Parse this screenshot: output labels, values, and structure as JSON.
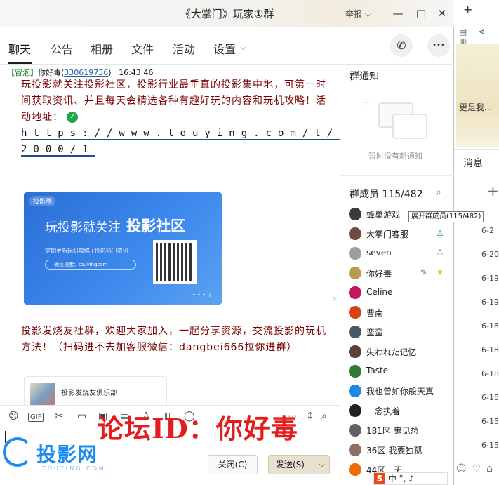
{
  "window": {
    "title": "《大掌门》玩家①群",
    "report": "举报",
    "btn_min": "—",
    "btn_max": "□",
    "btn_close": "✕"
  },
  "tabs": [
    "聊天",
    "公告",
    "相册",
    "文件",
    "活动",
    "设置"
  ],
  "tab_more": "⌵",
  "round_btns": {
    "phone": "✆",
    "more": "•••"
  },
  "message": {
    "tag": "【冒泡】",
    "sender": "你好毒",
    "uid": "330619736",
    "time": "16:43:46",
    "para1": "玩投影就关注投影社区，投影行业最垂直的投影集中地，可第一时间获取资讯、并且每天会精选各种有趣好玩的内容和玩机攻略！活动地址：",
    "verified": "✓",
    "link_line1": "https://www.touying.com/t/1",
    "link_line2": "2000/1",
    "banner": {
      "logo": "投影圈",
      "big1": "玩投影就关注",
      "big2": "投影社区",
      "small": "定期更新玩机攻略+投影热门资讯",
      "pill": "微信搜索：touyingcom",
      "dots": "• • • +"
    },
    "para2": "投影发烧友社群，欢迎大家加入，一起分享资源，交流投影的玩机方法！（扫码进不去加客服微信：dangbei666拉你进群）",
    "card_title": "投影发烧友俱乐部"
  },
  "toolbar": [
    "☺",
    "GIF",
    "✂",
    "▭",
    "▣",
    "▤",
    "♙",
    "▥",
    "◯",
    "⋯",
    "↕",
    "⌕"
  ],
  "watermark": {
    "text": "投影网",
    "sub": "TOUYING.COM"
  },
  "overlay": "论坛ID：你好毒",
  "buttons": {
    "close": "关闭(C)",
    "send": "发送(S)",
    "send_arrow": "⌵"
  },
  "notice": {
    "title": "群通知",
    "empty": "暂时没有新通知"
  },
  "members": {
    "header": "群成员 115/482",
    "tooltip": "展开群成员(115/482)",
    "list": [
      {
        "name": "蜂巢游戏",
        "color": "#3a3a3a",
        "badge": ""
      },
      {
        "name": "大掌门客服",
        "color": "#6d4c41",
        "badge": "♙"
      },
      {
        "name": "seven",
        "color": "#9e9e9e",
        "badge": "♙"
      },
      {
        "name": "你好毒",
        "color": "#b89c4a",
        "badge": "★",
        "edit": "✎"
      },
      {
        "name": "Celine",
        "color": "#c2185b",
        "badge": ""
      },
      {
        "name": "曹南",
        "color": "#d84315",
        "badge": ""
      },
      {
        "name": "蛮蛮",
        "color": "#455a64",
        "badge": ""
      },
      {
        "name": "失われた记忆",
        "color": "#5d4037",
        "badge": ""
      },
      {
        "name": "Taste",
        "color": "#2e7d32",
        "badge": ""
      },
      {
        "name": "我也曾如你般天真",
        "color": "#1e88e5",
        "badge": ""
      },
      {
        "name": "一念执着",
        "color": "#212121",
        "badge": ""
      },
      {
        "name": "181区 鬼见愁",
        "color": "#616161",
        "badge": ""
      },
      {
        "name": "36区-我要独孤",
        "color": "#8d6e63",
        "badge": ""
      },
      {
        "name": "44区一天",
        "color": "#ef6c00",
        "badge": ""
      }
    ]
  },
  "bg_window": {
    "plus": "+",
    "msg_tab": "消息",
    "preview": "更是我...",
    "dates": [
      "6-2",
      "6-20",
      "6-19",
      "6-19",
      "6-18",
      "6-18",
      "6-18",
      "6-15",
      "6-15",
      "6-15"
    ]
  },
  "ime": {
    "s": "S",
    "text": "中 °, ♪"
  }
}
